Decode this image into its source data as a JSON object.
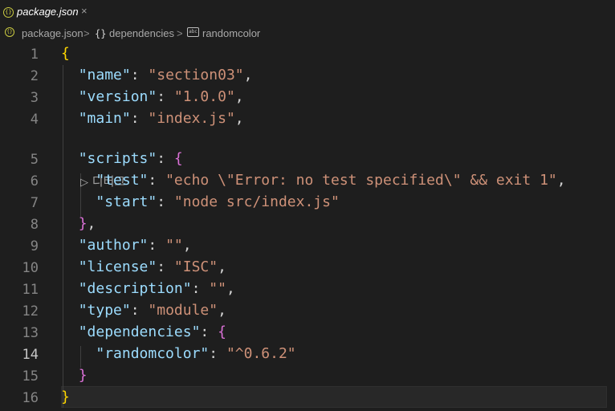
{
  "tab": {
    "title": "package.json",
    "icon": "json-file-icon",
    "close": "×"
  },
  "breadcrumb": {
    "file": "package.json",
    "sep1": ">",
    "braces": "{}",
    "section": "dependencies",
    "sep2": ">",
    "abc": "abc",
    "item": "randomcolor"
  },
  "codelens": {
    "arrow": "▷",
    "label": "디버그"
  },
  "active_line": 14,
  "lines": [
    {
      "n": "1",
      "text": "{"
    },
    {
      "n": "2",
      "key": "\"name\"",
      "value": "\"section03\"",
      "tail": ","
    },
    {
      "n": "3",
      "key": "\"version\"",
      "value": "\"1.0.0\"",
      "tail": ","
    },
    {
      "n": "4",
      "key": "\"main\"",
      "value": "\"index.js\"",
      "tail": ","
    },
    {
      "n": "5",
      "key": "\"scripts\"",
      "open": "{"
    },
    {
      "n": "6",
      "key": "\"test\"",
      "value": "\"echo \\\"Error: no test specified\\\" && exit 1\"",
      "tail": ","
    },
    {
      "n": "7",
      "key": "\"start\"",
      "value": "\"node src/index.js\""
    },
    {
      "n": "8",
      "close": "}",
      "tail": ","
    },
    {
      "n": "9",
      "key": "\"author\"",
      "value": "\"\"",
      "tail": ","
    },
    {
      "n": "10",
      "key": "\"license\"",
      "value": "\"ISC\"",
      "tail": ","
    },
    {
      "n": "11",
      "key": "\"description\"",
      "value": "\"\"",
      "tail": ","
    },
    {
      "n": "12",
      "key": "\"type\"",
      "value": "\"module\"",
      "tail": ","
    },
    {
      "n": "13",
      "key": "\"dependencies\"",
      "open": "{"
    },
    {
      "n": "14",
      "key": "\"randomcolor\"",
      "value": "\"^0.6.2\""
    },
    {
      "n": "15",
      "close": "}"
    },
    {
      "n": "16",
      "text": "}"
    }
  ],
  "colors": {
    "background": "#1e1e1e",
    "property_key": "#9cdcfe",
    "string_value": "#ce9178",
    "bracket_level1": "#ffd700",
    "bracket_level2": "#da70d6",
    "line_number": "#858585"
  }
}
